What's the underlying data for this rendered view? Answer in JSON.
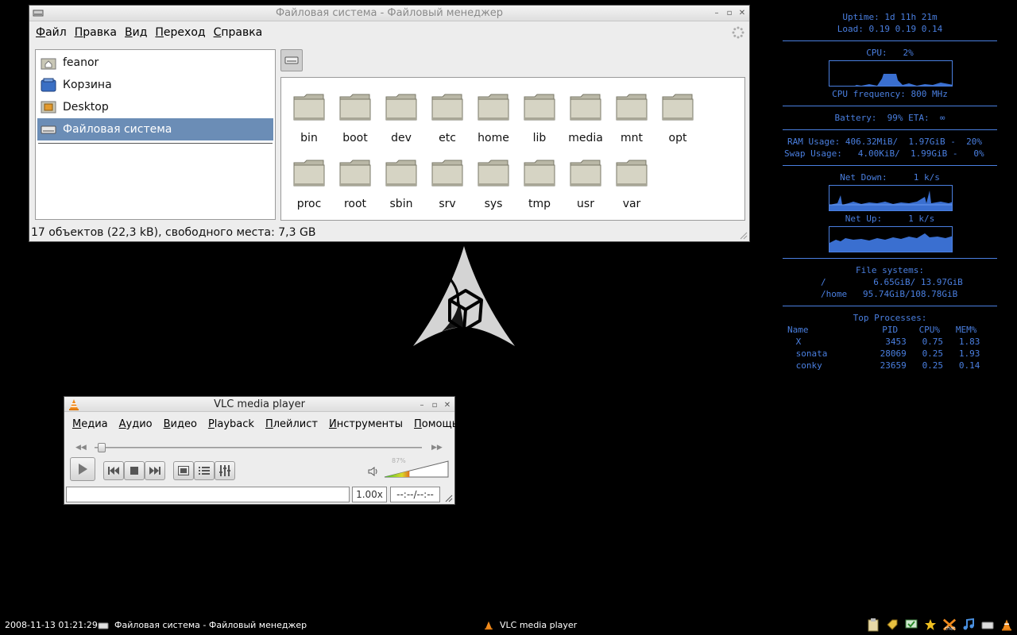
{
  "file_manager": {
    "title": "Файловая система - Файловый менеджер",
    "menu": [
      {
        "first": "Ф",
        "rest": "айл"
      },
      {
        "first": "П",
        "rest": "равка"
      },
      {
        "first": "В",
        "rest": "ид"
      },
      {
        "first": "П",
        "rest": "ереход"
      },
      {
        "first": "С",
        "rest": "правка"
      }
    ],
    "sidebar": [
      {
        "label": "feanor",
        "icon": "home-folder-icon"
      },
      {
        "label": "Корзина",
        "icon": "trash-icon"
      },
      {
        "label": "Desktop",
        "icon": "desktop-icon"
      },
      {
        "label": "Файловая система",
        "icon": "drive-icon",
        "selected": true
      }
    ],
    "folders": [
      "bin",
      "boot",
      "dev",
      "etc",
      "home",
      "lib",
      "media",
      "mnt",
      "opt",
      "proc",
      "root",
      "sbin",
      "srv",
      "sys",
      "tmp",
      "usr",
      "var"
    ],
    "status": "17 объектов (22,3 kB), свободного места: 7,3 GB"
  },
  "vlc": {
    "title": "VLC media player",
    "menu": [
      {
        "first": "М",
        "rest": "едиа"
      },
      {
        "first": "А",
        "rest": "удио"
      },
      {
        "first": "В",
        "rest": "идео"
      },
      {
        "first": "P",
        "rest": "layback"
      },
      {
        "first": "П",
        "rest": "лейлист"
      },
      {
        "first": "И",
        "rest": "нструменты"
      },
      {
        "first": "П",
        "rest": "омощь"
      }
    ],
    "volume_label": "87%",
    "volume_level": 0.87,
    "speed": "1.00x",
    "time": "--:--/--:--"
  },
  "conky": {
    "uptime": "Uptime: 1d 11h 21m",
    "load": "Load: 0.19 0.19 0.14",
    "cpu": "CPU:   2%",
    "cpu_freq": "CPU frequency: 800 MHz",
    "battery": "Battery:  99% ETA:  ∞",
    "ram": "RAM Usage: 406.32MiB/  1.97GiB -  20%",
    "swap": "Swap Usage:   4.00KiB/  1.99GiB -   0%",
    "net_down": "Net Down:     1 k/s",
    "net_up": "Net Up:     1 k/s",
    "fs_title": "File systems:",
    "fs_root": "/         6.65GiB/ 13.97GiB",
    "fs_home": "/home   95.74GiB/108.78GiB",
    "top_title": "Top Processes:",
    "proc_header": "Name              PID    CPU%   MEM%",
    "procs": [
      " X                3453   0.75   1.83",
      " sonata          28069   0.25   1.93",
      " conky           23659   0.25   0.14"
    ],
    "color": "#4a7fe0"
  },
  "taskbar": {
    "clock": "2008-11-13 01:21:29",
    "task_fm": "Файловая система - Файловый менеджер",
    "task_vlc": "VLC media player"
  }
}
